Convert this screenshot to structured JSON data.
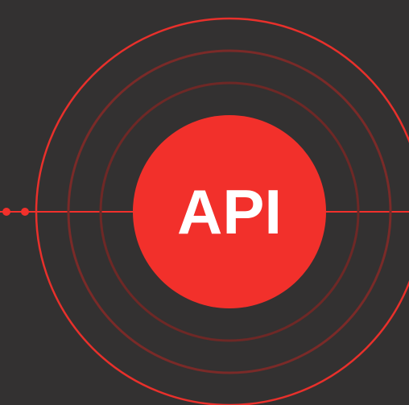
{
  "badge": {
    "label": "API"
  },
  "colors": {
    "background": "#333131",
    "accent": "#f2302b",
    "accent_dim": "#7a2a28",
    "accent_mid": "#a8302c",
    "label_text": "#ffffff"
  },
  "icons": {
    "connector": "connector-dots-icon",
    "rings": "concentric-rings-icon"
  }
}
